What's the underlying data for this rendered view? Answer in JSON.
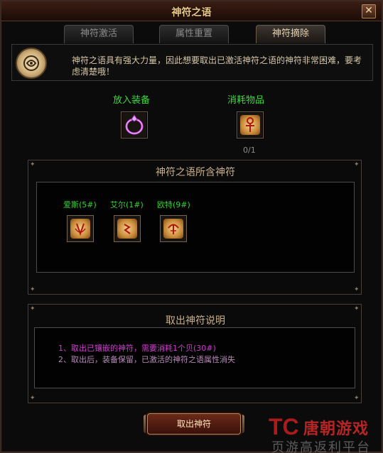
{
  "window": {
    "title": "神符之语"
  },
  "tabs": [
    {
      "label": "神符激活",
      "active": false
    },
    {
      "label": "属性重置",
      "active": false
    },
    {
      "label": "神符摘除",
      "active": true
    }
  ],
  "description": "神符之语具有强大力量，因此想要取出已激活神符之语的神符非常困难，要考虑清楚哦！",
  "slots": {
    "equip_label": "放入装备",
    "consume_label": "消耗物品",
    "consume_count": "0/1",
    "equip_icon": "ring-icon",
    "consume_icon": "ankh-rune-icon"
  },
  "runes_section": {
    "title": "神符之语所含神符",
    "runes": [
      {
        "name": "爱斯",
        "code": "(5#)",
        "icon": "rune-ais-icon"
      },
      {
        "name": "艾尔",
        "code": "(1#)",
        "icon": "rune-el-icon"
      },
      {
        "name": "欧特",
        "code": "(9#)",
        "icon": "rune-ort-icon"
      }
    ]
  },
  "notes_section": {
    "title": "取出神符说明",
    "lines": [
      "1、取出已镶嵌的神符，需要消耗1个贝(30#)",
      "2、取出后，装备保留，已激活的神符之语属性消失"
    ],
    "line_colors": [
      "#d23ad2",
      "#b88ab8"
    ]
  },
  "button": {
    "label": "取出神符"
  },
  "watermark": {
    "logo": "TC",
    "text1": "唐朝游戏",
    "text2": "页游高返利平台"
  },
  "colors": {
    "accent_green": "#3ed83e",
    "title_gold": "#e8c889",
    "watermark_red": "#d42a2a"
  }
}
